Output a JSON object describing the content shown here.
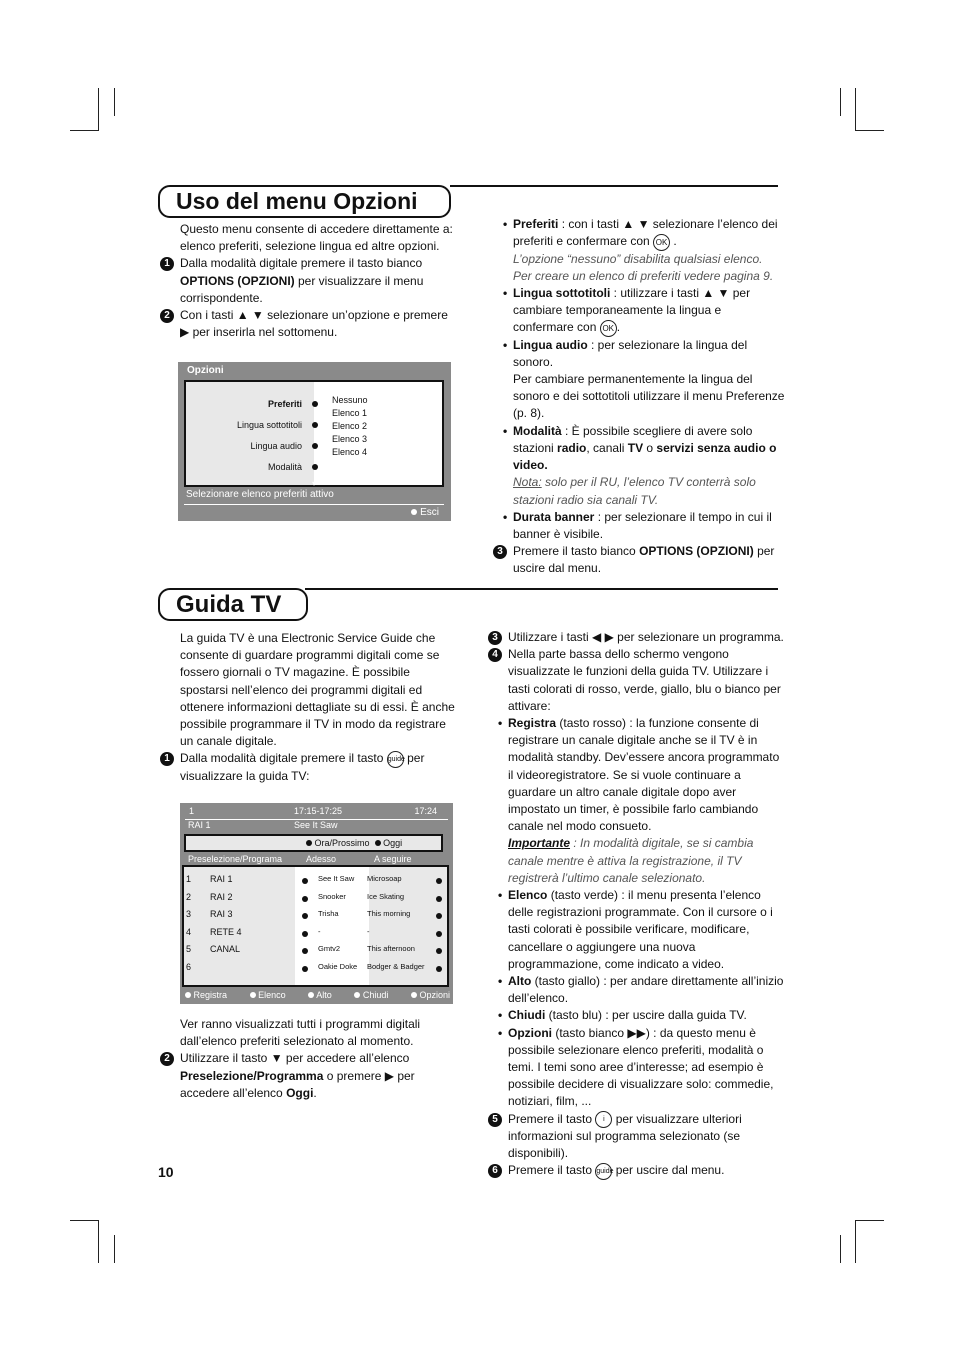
{
  "section1": {
    "title": "Uso del menu Opzioni",
    "left": [
      {
        "num": "",
        "segs": [
          [
            "Questo menu consente di accedere direttamente a: elenco preferiti, selezione lingua ed altre opzioni.",
            ""
          ]
        ]
      },
      {
        "num": "1",
        "segs": [
          [
            "Dalla modalità digitale premere il tasto bianco ",
            ""
          ],
          [
            "OPTIONS (OPZIONI)",
            "b"
          ],
          [
            " per visualizzare il menu corrispondente.",
            ""
          ]
        ]
      },
      {
        "num": "2",
        "segs": [
          [
            "Con i tasti ▲ ▼  selezionare un’opzione e premere ▶ per inserirla nel sottomenu.",
            ""
          ]
        ]
      }
    ],
    "right": [
      {
        "bullet": true,
        "segs": [
          [
            "Preferiti",
            "b"
          ],
          [
            " : con i tasti ▲ ▼  selezionare l’elenco dei preferiti e confermare con ",
            ""
          ],
          [
            "OK",
            "ok"
          ],
          [
            " .",
            ""
          ],
          [
            "\nL’opzione “nessuno” disabilita qualsiasi elenco.\nPer creare un elenco di preferiti vedere pagina 9.",
            "i"
          ]
        ]
      },
      {
        "bullet": true,
        "segs": [
          [
            "Lingua sottotitoli",
            "b"
          ],
          [
            " : utilizzare i tasti ▲ ▼  per cambiare temporaneamente la lingua e confermare con ",
            ""
          ],
          [
            "OK",
            "ok"
          ],
          [
            ".",
            ""
          ]
        ]
      },
      {
        "bullet": true,
        "segs": [
          [
            "Lingua audio",
            "b"
          ],
          [
            " : per selezionare la lingua del sonoro.\nPer cambiare permanentemente la lingua del sonoro e dei sottotitoli utilizzare il menu Preferenze (p. 8).",
            ""
          ]
        ]
      },
      {
        "bullet": true,
        "segs": [
          [
            "Modalità",
            "b"
          ],
          [
            " : È possibile scegliere di avere solo stazioni ",
            ""
          ],
          [
            "radio",
            "b"
          ],
          [
            ", canali ",
            ""
          ],
          [
            "TV",
            "b"
          ],
          [
            " o ",
            ""
          ],
          [
            "servizi senza audio o video.",
            "b"
          ],
          [
            "\n",
            ""
          ],
          [
            "Nota:",
            "i u"
          ],
          [
            " solo per il RU, l’elenco TV conterrà solo stazioni radio sia canali TV.",
            "i"
          ]
        ]
      },
      {
        "bullet": true,
        "segs": [
          [
            "Durata banner",
            "b"
          ],
          [
            " :  per selezionare il tempo in cui il banner è visibile.",
            ""
          ]
        ]
      },
      {
        "num": "3",
        "segs": [
          [
            "Premere il tasto bianco ",
            ""
          ],
          [
            "OPTIONS (OPZIONI)",
            "b"
          ],
          [
            " per uscire dal menu.",
            ""
          ]
        ]
      }
    ],
    "screen": {
      "header": "Opzioni",
      "items": [
        "Preferiti",
        "Lingua sottotitoli",
        "Lingua audio",
        "Modalità"
      ],
      "options": [
        "Nessuno",
        "Elenco 1",
        "Elenco 2",
        "Elenco 3",
        "Elenco 4"
      ],
      "status": "Selezionare elenco preferiti attivo",
      "exit": "Esci"
    }
  },
  "section2": {
    "title": "Guida TV",
    "left": [
      {
        "num": "",
        "segs": [
          [
            "La guida TV è una Electronic Service Guide che consente di guardare programmi digitali come se fossero giornali o TV magazine. È possibile spostarsi nell’elenco dei programmi digitali ed ottenere informazioni dettagliate su di essi. È anche possibile programmare il TV in modo da registrare un canale digitale.",
            ""
          ]
        ]
      },
      {
        "num": "1",
        "segs": [
          [
            "Dalla modalità digitale premere il tasto ",
            ""
          ],
          [
            "guide",
            "key"
          ],
          [
            " per visualizzare la guida TV:",
            ""
          ]
        ]
      }
    ],
    "left2": [
      {
        "num": "",
        "segs": [
          [
            "Ver ranno visualizzati tutti i programmi digitali dall’elenco preferiti selezionato al momento.",
            ""
          ]
        ]
      },
      {
        "num": "2",
        "segs": [
          [
            "Utilizzare il tasto ▼  per accedere all’elenco ",
            ""
          ],
          [
            "Preselezione/Programma",
            "b"
          ],
          [
            " o premere ▶ per accedere all’elenco ",
            ""
          ],
          [
            "Oggi",
            "b"
          ],
          [
            ".",
            ""
          ]
        ]
      }
    ],
    "right": [
      {
        "num": "3",
        "segs": [
          [
            "Utilizzare i tasti ◀ ▶ per selezionare un programma.",
            ""
          ]
        ]
      },
      {
        "num": "4",
        "segs": [
          [
            "Nella parte bassa dello schermo vengono visualizzate le funzioni della guida TV. Utilizzare i tasti colorati di rosso, verde, giallo, blu o bianco per attivare:",
            ""
          ]
        ]
      },
      {
        "bullet": true,
        "segs": [
          [
            "Registra",
            "b"
          ],
          [
            " (tasto rosso) :  la funzione consente di registrare un canale digitale anche se il TV è in modalità standby. Dev’essere ancora programmato il videoregistratore. Se si vuole continuare a guardare un altro canale digitale dopo aver impostato un timer, è possibile farlo cambiando canale nel modo consueto.\n",
            ""
          ],
          [
            "Importante",
            "bi"
          ],
          [
            " : In modalità digitale, se si cambia canale mentre è attiva la registrazione, il TV registrerà l’ultimo canale selezionato.",
            "i"
          ]
        ]
      },
      {
        "bullet": true,
        "segs": [
          [
            "Elenco",
            "b"
          ],
          [
            " (tasto verde) : il menu presenta l’elenco delle registrazioni programmate. Con il cursore o i tasti colorati è possibile verificare, modificare, cancellare o aggiungere una nuova programmazione, come indicato a video.",
            ""
          ]
        ]
      },
      {
        "bullet": true,
        "segs": [
          [
            "Alto",
            "b"
          ],
          [
            " (tasto giallo) : per andare direttamente all’inizio dell’elenco.",
            ""
          ]
        ]
      },
      {
        "bullet": true,
        "segs": [
          [
            "Chiudi",
            "b"
          ],
          [
            " (tasto blu) : per uscire dalla guida TV.",
            ""
          ]
        ]
      },
      {
        "bullet": true,
        "segs": [
          [
            "Opzioni",
            "b"
          ],
          [
            " (tasto bianco ▶▶) : da questo menu è possibile selezionare elenco preferiti, modalità o temi. I temi sono aree d’interesse; ad esempio è possibile decidere di visualizzare solo: commedie, notiziari, film, ...",
            ""
          ]
        ]
      },
      {
        "num": "5",
        "segs": [
          [
            "Premere il tasto ",
            ""
          ],
          [
            "i",
            "key"
          ],
          [
            " per visualizzare ulteriori informazioni sul programma selezionato (se disponibili).",
            ""
          ]
        ]
      },
      {
        "num": "6",
        "segs": [
          [
            "Premere il tasto ",
            ""
          ],
          [
            "guide",
            "key"
          ],
          [
            " per uscire dal menu.",
            ""
          ]
        ]
      }
    ],
    "screen": {
      "channel": "1",
      "time_range": "17:15-17:25",
      "clock": "17:24",
      "channel_name": "RAI 1",
      "now_title": "See It Saw",
      "filters": [
        "Ora/Prossimo",
        "Oggi"
      ],
      "columns": [
        "Preselezione/Programa",
        "Adesso",
        "A seguire"
      ],
      "rows": [
        {
          "n": "1",
          "name": "RAI 1",
          "now": "See It Saw",
          "next": "Microsoap"
        },
        {
          "n": "2",
          "name": "RAI 2",
          "now": "Snooker",
          "next": "Ice Skating"
        },
        {
          "n": "3",
          "name": "RAI 3",
          "now": "Trisha",
          "next": "This morning"
        },
        {
          "n": "4",
          "name": "RETE 4",
          "now": "-",
          "next": "-"
        },
        {
          "n": "5",
          "name": "CANAL",
          "now": "Gmtv2",
          "next": "This afternoon"
        },
        {
          "n": "6",
          "name": "",
          "now": "Oakie Doke",
          "next": "Bodger & Badger"
        }
      ],
      "buttons": [
        "Registra",
        "Elenco",
        "Alto",
        "Chiudi",
        "Opzioni"
      ]
    }
  },
  "page_number": "10"
}
